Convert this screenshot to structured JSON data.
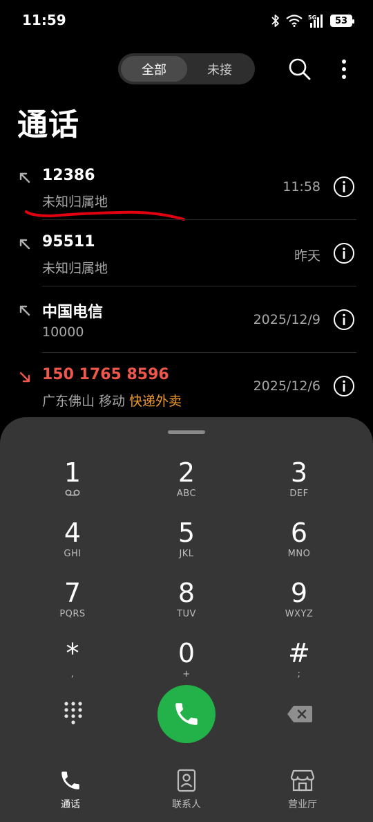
{
  "status": {
    "time": "11:59",
    "battery": "53",
    "network": "5G"
  },
  "filter": {
    "all_label": "全部",
    "missed_label": "未接",
    "selected": "全部"
  },
  "page": {
    "title": "通话"
  },
  "calls": [
    {
      "name": "12386",
      "sub": "未知归属地",
      "tag": "",
      "time": "11:58",
      "type": "outgoing"
    },
    {
      "name": "95511",
      "sub": "未知归属地",
      "tag": "",
      "time": "昨天",
      "type": "outgoing"
    },
    {
      "name": "中国电信",
      "sub": "10000",
      "tag": "",
      "time": "2025/12/9",
      "type": "outgoing"
    },
    {
      "name": "150 1765 8596",
      "sub": "广东佛山 移动",
      "tag": "快递外卖",
      "time": "2025/12/6",
      "type": "missed"
    }
  ],
  "dialpad": {
    "keys": [
      {
        "num": "1",
        "letters": ""
      },
      {
        "num": "2",
        "letters": "ABC"
      },
      {
        "num": "3",
        "letters": "DEF"
      },
      {
        "num": "4",
        "letters": "GHI"
      },
      {
        "num": "5",
        "letters": "JKL"
      },
      {
        "num": "6",
        "letters": "MNO"
      },
      {
        "num": "7",
        "letters": "PQRS"
      },
      {
        "num": "8",
        "letters": "TUV"
      },
      {
        "num": "9",
        "letters": "WXYZ"
      },
      {
        "num": "*",
        "letters": ","
      },
      {
        "num": "0",
        "letters": "+"
      },
      {
        "num": "#",
        "letters": ";"
      }
    ]
  },
  "nav": {
    "calls": "通话",
    "contacts": "联系人",
    "hall": "营业厅",
    "active": "通话"
  },
  "colors": {
    "accent_green": "#23b14a",
    "missed_red": "#f0574b",
    "tag_orange": "#f39c2f",
    "annotation_red": "#e0000f"
  }
}
